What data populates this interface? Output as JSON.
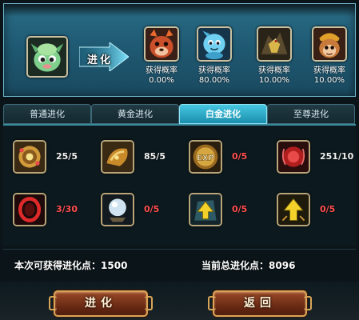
{
  "evolution": {
    "action_label": "进化",
    "current_pet_icon": "green-dragon-pet-icon",
    "targets": [
      {
        "icon": "fire-bear-pet-icon",
        "label": "获得概率",
        "value": "0.00%"
      },
      {
        "icon": "blue-water-pet-icon",
        "label": "获得概率",
        "value": "80.00%"
      },
      {
        "icon": "dark-eagle-pet-icon",
        "label": "获得概率",
        "value": "10.00%"
      },
      {
        "icon": "monkey-king-pet-icon",
        "label": "获得概率",
        "value": "10.00%"
      }
    ]
  },
  "tabs": [
    {
      "label": "普通进化",
      "active": false
    },
    {
      "label": "黄金进化",
      "active": false
    },
    {
      "label": "白金进化",
      "active": true
    },
    {
      "label": "至尊进化",
      "active": false
    }
  ],
  "materials": [
    {
      "icon": "golden-amulet-icon",
      "count": "25/5",
      "low": false
    },
    {
      "icon": "golden-dragon-egg-icon",
      "count": "85/5",
      "low": false
    },
    {
      "icon": "exp-orb-icon",
      "count": "0/5",
      "low": true
    },
    {
      "icon": "red-dragon-orb-icon",
      "count": "251/10",
      "low": false
    },
    {
      "icon": "red-dragon-ring-icon",
      "count": "3/30",
      "low": true
    },
    {
      "icon": "crystal-ball-icon",
      "count": "0/5",
      "low": true
    },
    {
      "icon": "upgrade-arrow-icon",
      "count": "0/5",
      "low": true
    },
    {
      "icon": "gold-upgrade-arrow-icon",
      "count": "0/5",
      "low": true
    }
  ],
  "stats": {
    "obtainable_label": "本次可获得进化点：",
    "obtainable_value": "1500",
    "total_label": "当前总进化点：",
    "total_value": "8096"
  },
  "buttons": {
    "evolve": "进化",
    "back": "返回"
  },
  "colors": {
    "active_tab": "#46c7e2",
    "insufficient_count": "#ff4f4f",
    "button_border": "#d9a457"
  }
}
